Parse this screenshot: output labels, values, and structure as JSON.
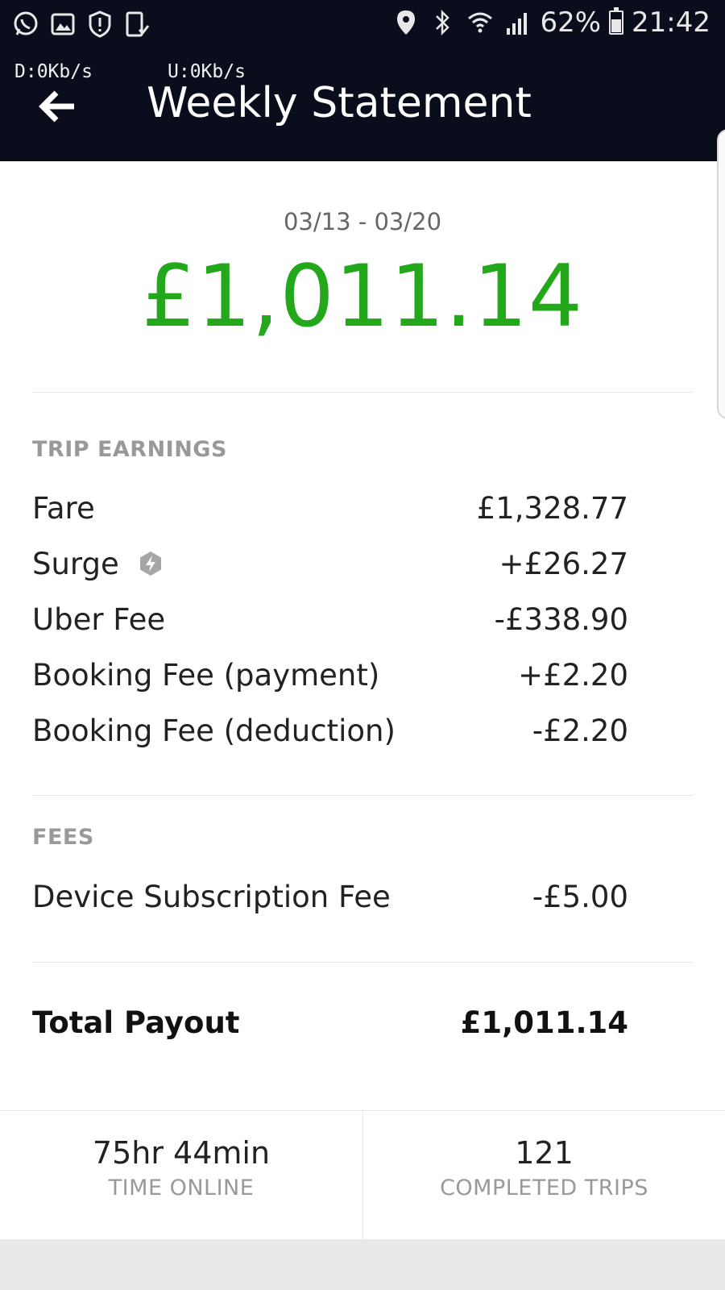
{
  "status_bar": {
    "battery": "62%",
    "time": "21:42",
    "left_icons": [
      "whatsapp-icon",
      "gallery-icon",
      "shield-icon",
      "device-check-icon"
    ],
    "right_icons": [
      "location-icon",
      "bluetooth-icon",
      "wifi-icon",
      "signal-icon",
      "battery-icon"
    ],
    "battery_level": 0.62
  },
  "header": {
    "download_speed": "D:0Kb/s",
    "upload_speed": "U:0Kb/s",
    "title": "Weekly Statement"
  },
  "summary": {
    "date_range": "03/13 - 03/20",
    "total": "£1,011.14"
  },
  "trip_earnings": {
    "title": "TRIP EARNINGS",
    "items": [
      {
        "label": "Fare",
        "value": "£1,328.77"
      },
      {
        "label": "Surge",
        "value": "+£26.27"
      },
      {
        "label": "Uber Fee",
        "value": "-£338.90"
      },
      {
        "label": "Booking Fee (payment)",
        "value": "+£2.20"
      },
      {
        "label": "Booking Fee (deduction)",
        "value": "-£2.20"
      }
    ]
  },
  "fees": {
    "title": "FEES",
    "items": [
      {
        "label": "Device Subscription Fee",
        "value": "-£5.00"
      }
    ]
  },
  "total_payout": {
    "label": "Total Payout",
    "value": "£1,011.14"
  },
  "stats": {
    "time_online": {
      "value": "75hr 44min",
      "label": "TIME ONLINE"
    },
    "completed_trips": {
      "value": "121",
      "label": "COMPLETED TRIPS"
    }
  },
  "colors": {
    "header_bg": "#0a0d1c",
    "accent_green": "#24a81b",
    "section_gray": "#999999"
  }
}
